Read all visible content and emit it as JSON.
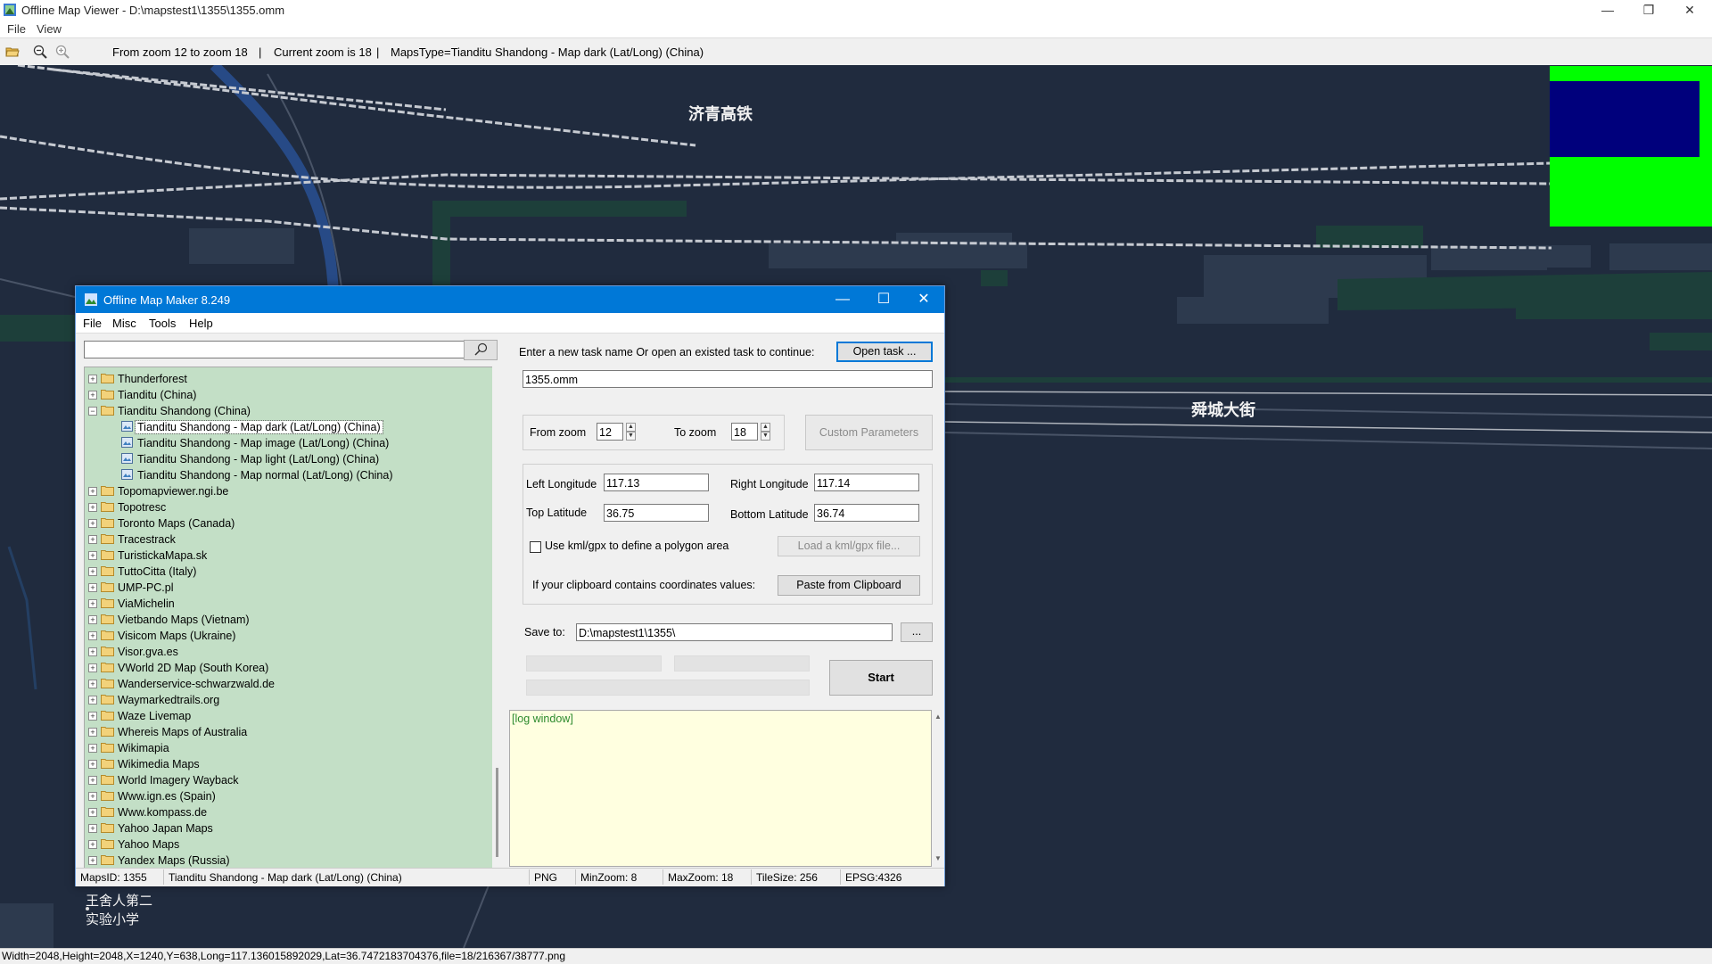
{
  "window": {
    "title": "Offline Map Viewer - D:\\mapstest1\\1355\\1355.omm",
    "controls": {
      "minimize": "—",
      "maximize": "❐",
      "close": "✕"
    }
  },
  "menu": [
    "File",
    "View"
  ],
  "toolbar": {
    "zoom_range": "From zoom 12 to zoom 18",
    "sep1": "|",
    "current_zoom": "Current zoom is 18",
    "sep2": "|",
    "maps_type": "MapsType=Tianditu Shandong - Map dark (Lat/Long) (China)"
  },
  "map_labels": {
    "railway": "济青高铁",
    "street": "舜城大街",
    "school_line1": "王舍人第二",
    "school_line2": "实验小学"
  },
  "status": "Width=2048,Height=2048,X=1240,Y=638,Long=117.136015892029,Lat=36.7472183704376,file=18/216367/38777.png",
  "dialog": {
    "title": "Offline Map Maker 8.249",
    "menu": [
      "File",
      "Misc",
      "Tools",
      "Help"
    ],
    "search": {
      "value": "",
      "placeholder": ""
    },
    "tree": [
      {
        "label": "Thunderforest",
        "level": 0,
        "expanded": false
      },
      {
        "label": "Tianditu (China)",
        "level": 0,
        "expanded": false
      },
      {
        "label": "Tianditu Shandong (China)",
        "level": 0,
        "expanded": true
      },
      {
        "label": "Tianditu Shandong - Map dark (Lat/Long) (China)",
        "level": 1,
        "selected": true
      },
      {
        "label": "Tianditu Shandong - Map image (Lat/Long) (China)",
        "level": 1
      },
      {
        "label": "Tianditu Shandong - Map light (Lat/Long) (China)",
        "level": 1
      },
      {
        "label": "Tianditu Shandong - Map normal (Lat/Long) (China)",
        "level": 1
      },
      {
        "label": "Topomapviewer.ngi.be",
        "level": 0,
        "expanded": false
      },
      {
        "label": "Topotresc",
        "level": 0,
        "expanded": false
      },
      {
        "label": "Toronto Maps (Canada)",
        "level": 0,
        "expanded": false
      },
      {
        "label": "Tracestrack",
        "level": 0,
        "expanded": false
      },
      {
        "label": "TuristickaMapa.sk",
        "level": 0,
        "expanded": false
      },
      {
        "label": "TuttoCitta (Italy)",
        "level": 0,
        "expanded": false
      },
      {
        "label": "UMP-PC.pl",
        "level": 0,
        "expanded": false
      },
      {
        "label": "ViaMichelin",
        "level": 0,
        "expanded": false
      },
      {
        "label": "Vietbando Maps (Vietnam)",
        "level": 0,
        "expanded": false
      },
      {
        "label": "Visicom Maps (Ukraine)",
        "level": 0,
        "expanded": false
      },
      {
        "label": "Visor.gva.es",
        "level": 0,
        "expanded": false
      },
      {
        "label": "VWorld 2D Map (South Korea)",
        "level": 0,
        "expanded": false
      },
      {
        "label": "Wanderservice-schwarzwald.de",
        "level": 0,
        "expanded": false
      },
      {
        "label": "Waymarkedtrails.org",
        "level": 0,
        "expanded": false
      },
      {
        "label": "Waze Livemap",
        "level": 0,
        "expanded": false
      },
      {
        "label": "Whereis Maps of Australia",
        "level": 0,
        "expanded": false
      },
      {
        "label": "Wikimapia",
        "level": 0,
        "expanded": false
      },
      {
        "label": "Wikimedia Maps",
        "level": 0,
        "expanded": false
      },
      {
        "label": "World Imagery Wayback",
        "level": 0,
        "expanded": false
      },
      {
        "label": "Www.ign.es (Spain)",
        "level": 0,
        "expanded": false
      },
      {
        "label": "Www.kompass.de",
        "level": 0,
        "expanded": false
      },
      {
        "label": "Yahoo Japan Maps",
        "level": 0,
        "expanded": false
      },
      {
        "label": "Yahoo Maps",
        "level": 0,
        "expanded": false
      },
      {
        "label": "Yandex Maps (Russia)",
        "level": 0,
        "expanded": false
      }
    ],
    "task": {
      "prompt": "Enter a new task name Or open an existed task to continue:",
      "open_button": "Open task ...",
      "name": "1355.omm"
    },
    "zoom": {
      "from_label": "From zoom",
      "from_value": "12",
      "to_label": "To zoom",
      "to_value": "18",
      "custom_button": "Custom Parameters"
    },
    "coords": {
      "left_lon_label": "Left Longitude",
      "left_lon": "117.13",
      "right_lon_label": "Right Longitude",
      "right_lon": "117.14",
      "top_lat_label": "Top Latitude",
      "top_lat": "36.75",
      "bottom_lat_label": "Bottom Latitude",
      "bottom_lat": "36.74",
      "kml_checkbox_label": "Use kml/gpx to define a polygon area",
      "kml_checked": false,
      "load_kml_button": "Load a kml/gpx file...",
      "clipboard_label": "If your clipboard contains coordinates values:",
      "paste_button": "Paste from Clipboard"
    },
    "save": {
      "label": "Save to:",
      "path": "D:\\mapstest1\\1355\\",
      "browse_button": "..."
    },
    "start_button": "Start",
    "log_label": "[log window]",
    "statusbar": {
      "maps_id": "MapsID: 1355",
      "maps_name": "Tianditu Shandong - Map dark (Lat/Long) (China)",
      "format": "PNG",
      "min_zoom": "MinZoom: 8",
      "max_zoom": "MaxZoom: 18",
      "tile_size": "TileSize: 256",
      "epsg": "EPSG:4326"
    }
  },
  "colors": {
    "map_background": "#202b3e",
    "tree_background": "#c3dfc6",
    "log_background": "#ffffe0",
    "dialog_titlebar": "#0078d7",
    "overlay_green": "#00ff00",
    "overlay_blue": "#00007c"
  }
}
